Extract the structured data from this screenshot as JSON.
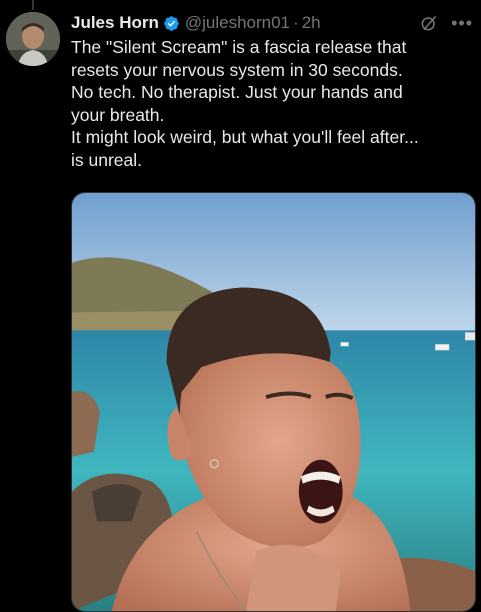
{
  "post": {
    "author_name": "Jules Horn",
    "handle": "@juleshorn01",
    "separator": "·",
    "time": "2h",
    "text_lines": [
      "The \"Silent Scream\" is a fascia release that",
      "resets your nervous system in 30 seconds.",
      "No tech. No therapist. Just your hands and",
      "your breath.",
      "It might look weird, but what you'll feel after...",
      "is unreal."
    ],
    "verified": true
  },
  "icons": {
    "verified": "verified-badge-icon",
    "grok": "grok-icon",
    "more": "more-options-icon"
  },
  "colors": {
    "background": "#000000",
    "text": "#e7e9ea",
    "secondary": "#71767b",
    "verified": "#1d9bf0"
  }
}
